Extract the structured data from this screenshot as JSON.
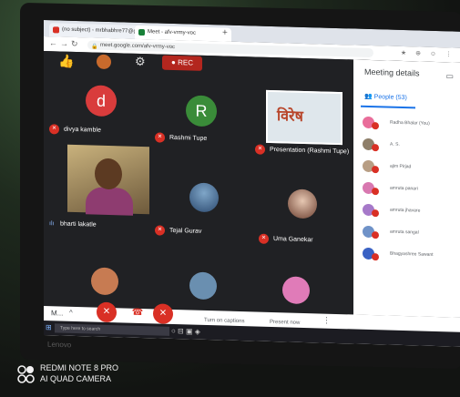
{
  "browser": {
    "tab1": "(no subject) - mrbhabhre77@g...",
    "tab2": "Meet - afv-vrmy-voc",
    "url": "meet.google.com/afv-vrmy-voc"
  },
  "meet": {
    "rec_label": "REC",
    "presentation_text": "विरेष",
    "participants": [
      {
        "name": "divya kamble",
        "initial": "d",
        "color": "#d93c3c"
      },
      {
        "name": "Rashmi Tupe",
        "initial": "R",
        "color": "#3a8c39"
      },
      {
        "name": "Presentation (Rashmi Tupe)"
      },
      {
        "name": "bharti lakatle"
      },
      {
        "name": "Tejal Gurav"
      },
      {
        "name": "Uma Ganekar"
      }
    ]
  },
  "sidebar": {
    "title": "Meeting details",
    "people_tab": "People (53)",
    "people": [
      {
        "name": "Radha Bhalar (You)",
        "color": "#e96d9a"
      },
      {
        "name": "A. S.",
        "color": "#8e7f6a"
      },
      {
        "name": "ajim Pirjad",
        "color": "#b89e84"
      },
      {
        "name": "amruta panari",
        "color": "#d878b0"
      },
      {
        "name": "amruta jhavare",
        "color": "#a679c9"
      },
      {
        "name": "amruta sangal",
        "color": "#6f92c8"
      },
      {
        "name": "Bhagyashree Sawant",
        "color": "#3a62c4"
      }
    ]
  },
  "controls": {
    "meeting_code_short": "M...",
    "captions_label": "Turn on captions",
    "present_label": "Present now"
  },
  "taskbar": {
    "search_placeholder": "Type here to search"
  },
  "device": {
    "brand": "Lenovo"
  },
  "watermark": {
    "line1": "REDMI NOTE 8 PRO",
    "line2": "AI QUAD CAMERA"
  }
}
